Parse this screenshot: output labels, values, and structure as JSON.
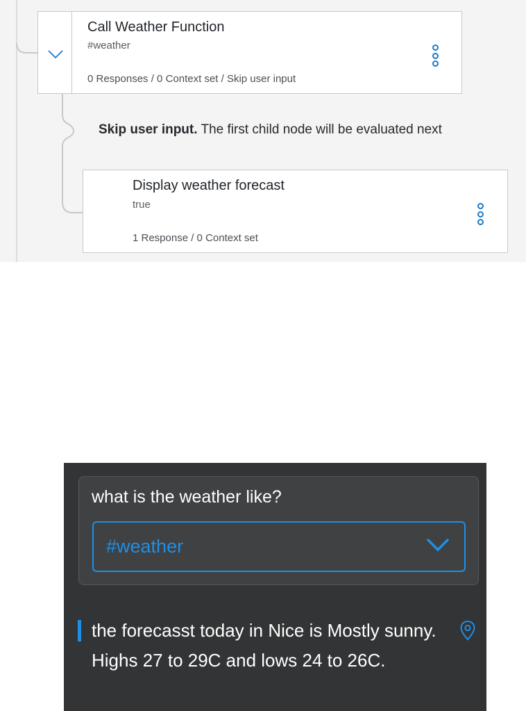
{
  "dialog_tree": {
    "parent_node": {
      "title": "Call Weather Function",
      "condition": "#weather",
      "meta": "0 Responses / 0 Context set / Skip user input"
    },
    "skip_note": {
      "label": "Skip user input.",
      "text": " The first child node will be evaluated next"
    },
    "child_node": {
      "title": "Display weather forecast",
      "condition": "true",
      "meta": "1 Response / 0 Context set"
    }
  },
  "chat_preview": {
    "user_message": "what is the weather like?",
    "intent_select": {
      "value": "#weather"
    },
    "bot_response": "the forecasst today in Nice is Mostly sunny. Highs 27 to 29C and lows 24 to 26C."
  },
  "colors": {
    "accent": "#1e8fe6",
    "kebab": "#1a79c6",
    "chat_bg": "#333435",
    "card_bg": "#3f4142",
    "tree_bg": "#f4f4f4"
  },
  "icons": [
    "chevron-down-icon",
    "overflow-menu-icon",
    "location-pin-icon"
  ]
}
